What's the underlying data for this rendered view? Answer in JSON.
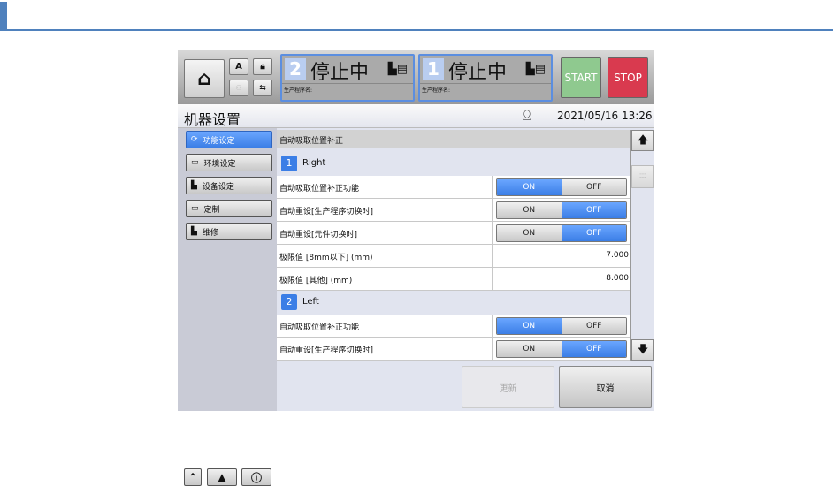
{
  "header": {
    "icons": {
      "home": "home-icon",
      "auto": "A",
      "lock": "lock-icon"
    },
    "stations": [
      {
        "number": "2",
        "status": "停止中",
        "program_label": "生产程序名:"
      },
      {
        "number": "1",
        "status": "停止中",
        "program_label": "生产程序名:"
      }
    ],
    "start_label": "START",
    "stop_label": "STOP"
  },
  "titlebar": {
    "title": "机器设置",
    "datetime": "2021/05/16 13:26"
  },
  "sidebar": {
    "items": [
      {
        "label": "功能设定",
        "active": true
      },
      {
        "label": "环境设定"
      },
      {
        "label": "设备设定"
      },
      {
        "label": "定制"
      },
      {
        "label": "维修"
      }
    ]
  },
  "content": {
    "group_title": "自动吸取位置补正",
    "sections": [
      {
        "number": "1",
        "name": "Right",
        "rows": [
          {
            "label": "自动吸取位置补正功能",
            "type": "toggle",
            "value": "ON"
          },
          {
            "label": "自动重设[生产程序切换时]",
            "type": "toggle",
            "value": "OFF"
          },
          {
            "label": "自动重设[元件切换时]",
            "type": "toggle",
            "value": "OFF"
          },
          {
            "label": "极限值 [8mm以下] (mm)",
            "type": "value",
            "value": "7.000"
          },
          {
            "label": "极限值 [其他] (mm)",
            "type": "value",
            "value": "8.000"
          }
        ]
      },
      {
        "number": "2",
        "name": "Left",
        "rows": [
          {
            "label": "自动吸取位置补正功能",
            "type": "toggle",
            "value": "ON"
          },
          {
            "label": "自动重设[生产程序切换时]",
            "type": "toggle",
            "value": "OFF"
          }
        ]
      }
    ],
    "on_label": "ON",
    "off_label": "OFF"
  },
  "footer": {
    "update_label": "更新",
    "cancel_label": "取消"
  }
}
